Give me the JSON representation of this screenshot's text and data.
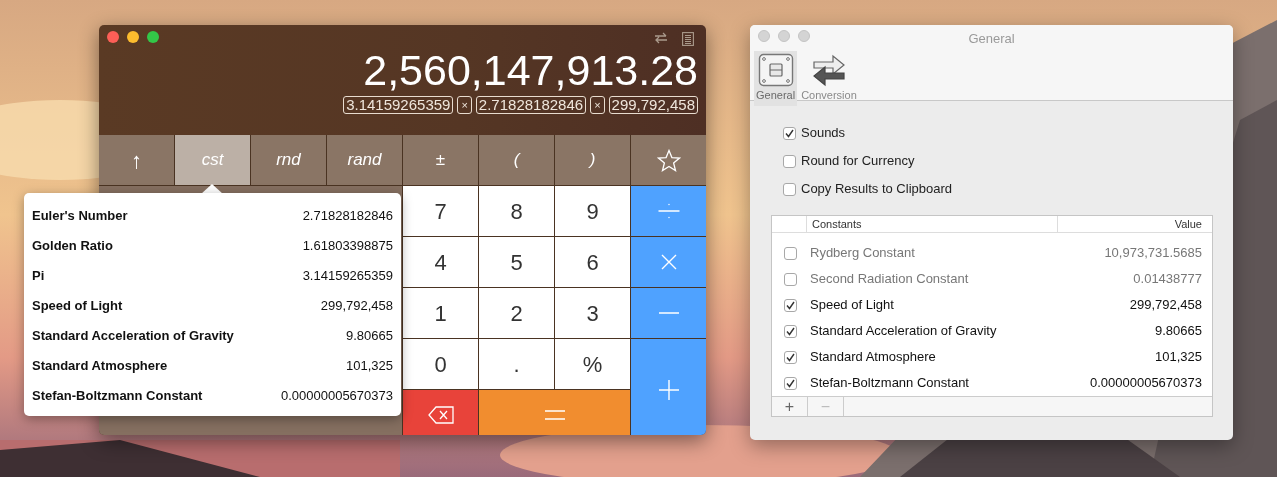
{
  "calculator": {
    "display": "2,560,147,913.28",
    "tape": [
      {
        "kind": "operand",
        "text": "3.14159265359"
      },
      {
        "kind": "operator",
        "text": "×"
      },
      {
        "kind": "operand",
        "text": "2.71828182846"
      },
      {
        "kind": "operator",
        "text": "×"
      },
      {
        "kind": "operand",
        "text": "299,792,458"
      }
    ],
    "function_keys": [
      {
        "kind": "arrow",
        "label": "↑",
        "selected": false
      },
      {
        "kind": "text",
        "label": "cst",
        "selected": true
      },
      {
        "kind": "text",
        "label": "rnd",
        "selected": false
      },
      {
        "kind": "text",
        "label": "rand",
        "selected": false
      },
      {
        "kind": "text",
        "label": "±",
        "selected": false
      },
      {
        "kind": "text",
        "label": "(",
        "selected": false
      },
      {
        "kind": "text",
        "label": ")",
        "selected": false
      },
      {
        "kind": "star",
        "selected": false
      }
    ],
    "keys": [
      {
        "kind": "digit",
        "label": "7"
      },
      {
        "kind": "digit",
        "label": "8"
      },
      {
        "kind": "digit",
        "label": "9"
      },
      {
        "kind": "divide"
      },
      {
        "kind": "digit",
        "label": "4"
      },
      {
        "kind": "digit",
        "label": "5"
      },
      {
        "kind": "digit",
        "label": "6"
      },
      {
        "kind": "multiply"
      },
      {
        "kind": "digit",
        "label": "1"
      },
      {
        "kind": "digit",
        "label": "2"
      },
      {
        "kind": "digit",
        "label": "3"
      },
      {
        "kind": "minus"
      },
      {
        "kind": "digit",
        "label": "0"
      },
      {
        "kind": "digit",
        "label": "."
      },
      {
        "kind": "digit",
        "label": "%"
      },
      {
        "kind": "plus"
      },
      {
        "kind": "delete"
      },
      {
        "kind": "equals"
      }
    ]
  },
  "constants_popover": {
    "items": [
      {
        "name": "Euler's Number",
        "value": "2.71828182846"
      },
      {
        "name": "Golden Ratio",
        "value": "1.61803398875"
      },
      {
        "name": "Pi",
        "value": "3.14159265359"
      },
      {
        "name": "Speed of Light",
        "value": "299,792,458"
      },
      {
        "name": "Standard Acceleration of Gravity",
        "value": "9.80665"
      },
      {
        "name": "Standard Atmosphere",
        "value": "101,325"
      },
      {
        "name": "Stefan-Boltzmann Constant",
        "value": "0.00000005670373"
      }
    ]
  },
  "preferences": {
    "window": {
      "title": "General"
    },
    "tabs": [
      {
        "label": "General",
        "kind": "general",
        "selected": true
      },
      {
        "label": "Conversion",
        "kind": "conversion",
        "selected": false
      }
    ],
    "options": [
      {
        "label": "Sounds",
        "checked": true
      },
      {
        "label": "Round for Currency",
        "checked": false
      },
      {
        "label": "Copy Results to Clipboard",
        "checked": false
      }
    ],
    "table": {
      "columns": [
        "Constants",
        "Value"
      ],
      "rows": [
        {
          "name": "Rydberg Constant",
          "value": "10,973,731.5685",
          "checked": false
        },
        {
          "name": "Second Radiation Constant",
          "value": "0.01438777",
          "checked": false
        },
        {
          "name": "Speed of Light",
          "value": "299,792,458",
          "checked": true
        },
        {
          "name": "Standard Acceleration of Gravity",
          "value": "9.80665",
          "checked": true
        },
        {
          "name": "Standard Atmosphere",
          "value": "101,325",
          "checked": true
        },
        {
          "name": "Stefan-Boltzmann Constant",
          "value": "0.00000005670373",
          "checked": true
        }
      ]
    },
    "table_buttons": [
      "+",
      "−"
    ]
  }
}
